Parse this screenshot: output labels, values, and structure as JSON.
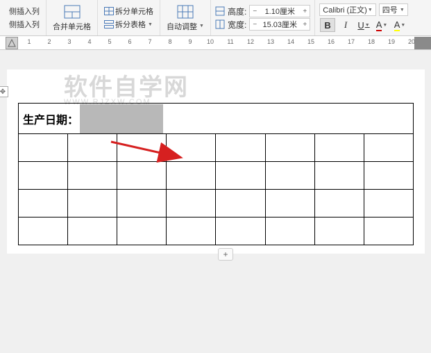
{
  "ribbon": {
    "insert_col_left": "侧插入列",
    "insert_col_right": "侧插入列",
    "merge_cells": "合并单元格",
    "split_cells": "拆分单元格",
    "split_table": "拆分表格",
    "auto_adjust": "自动调整",
    "height_label": "高度:",
    "width_label": "宽度:",
    "height_value": "1.10厘米",
    "width_value": "15.03厘米",
    "font_name": "Calibri (正文)",
    "font_size": "四号",
    "bold": "B",
    "italic": "I",
    "underline": "U",
    "font_color": "A",
    "highlight": "A"
  },
  "ruler": {
    "numbers": [
      "1",
      "2",
      "3",
      "4",
      "5",
      "6",
      "7",
      "8",
      "9",
      "10",
      "11",
      "12",
      "13",
      "14",
      "15",
      "16",
      "17",
      "18",
      "19",
      "20"
    ]
  },
  "watermark": {
    "text": "软件自学网",
    "url": "WWW.RJZXW.COM"
  },
  "table": {
    "header_label": "生产日期：",
    "rows": 5,
    "cols": 8
  }
}
